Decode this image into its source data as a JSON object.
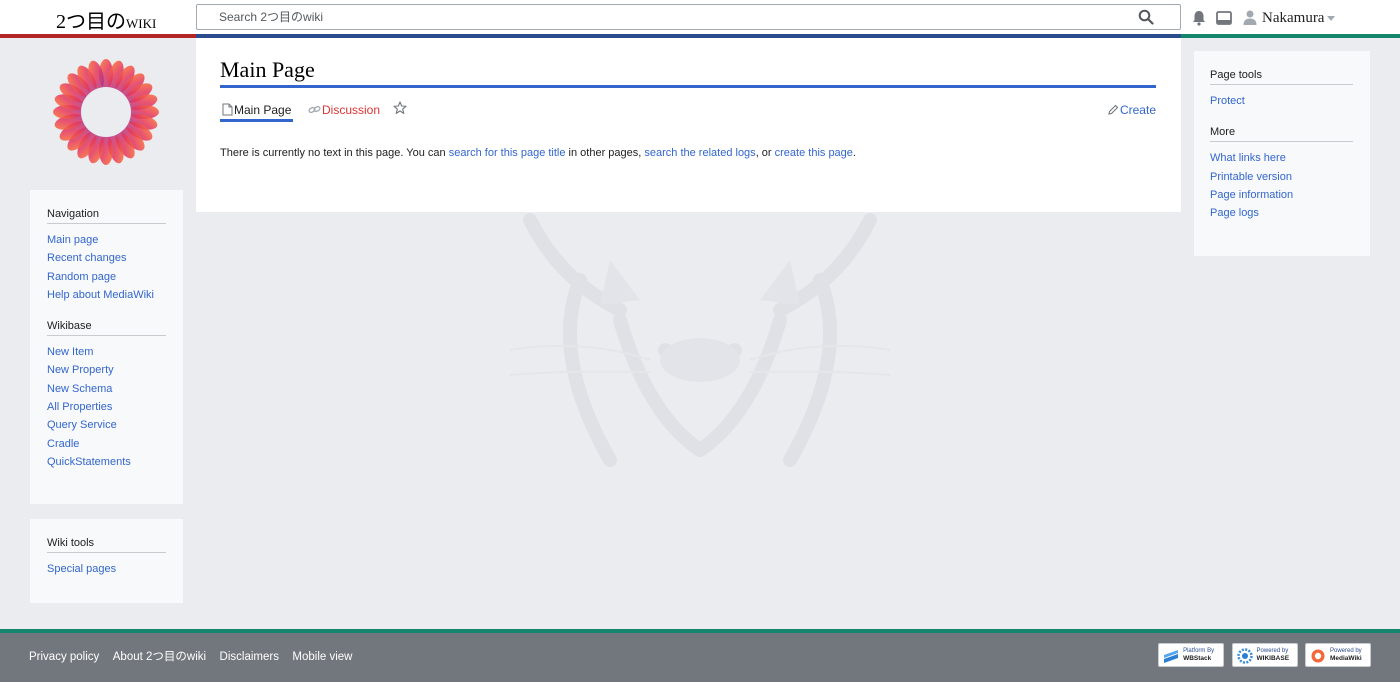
{
  "header": {
    "site_title_prefix": "2つ目の",
    "site_title_suffix": "wiki",
    "search_placeholder": "Search 2つ目のwiki",
    "username": "Nakamura"
  },
  "sidebar": {
    "navigation": {
      "heading": "Navigation",
      "items": [
        "Main page",
        "Recent changes",
        "Random page",
        "Help about MediaWiki"
      ]
    },
    "wikibase": {
      "heading": "Wikibase",
      "items": [
        "New Item",
        "New Property",
        "New Schema",
        "All Properties",
        "Query Service",
        "Cradle",
        "QuickStatements"
      ]
    },
    "wiki_tools": {
      "heading": "Wiki tools",
      "items": [
        "Special pages"
      ]
    }
  },
  "page": {
    "title": "Main Page",
    "tabs": {
      "main": "Main Page",
      "discussion": "Discussion",
      "create": "Create"
    },
    "body": {
      "t1": "There is currently no text in this page. You can ",
      "l1": "search for this page title",
      "t2": " in other pages, ",
      "l2": "search the related logs",
      "t3": ", or ",
      "l3": "create this page",
      "t4": "."
    }
  },
  "right_sidebar": {
    "page_tools": {
      "heading": "Page tools",
      "items": [
        "Protect"
      ]
    },
    "more": {
      "heading": "More",
      "items": [
        "What links here",
        "Printable version",
        "Page information",
        "Page logs"
      ]
    }
  },
  "footer": {
    "links": [
      "Privacy policy",
      "About 2つ目のwiki",
      "Disclaimers",
      "Mobile view"
    ],
    "badges": [
      {
        "top": "Platform By",
        "bottom": "WBStack"
      },
      {
        "top": "Powered by",
        "bottom": "WIKIBASE"
      },
      {
        "top": "Powered by",
        "bottom": "MediaWiki"
      }
    ]
  },
  "colors": {
    "link": "#3366cc",
    "red_link": "#dd3333",
    "stripe_red": "#b32424",
    "stripe_blue": "#2a4b8d",
    "stripe_green": "#14866d",
    "footer_bg": "#72777d"
  }
}
